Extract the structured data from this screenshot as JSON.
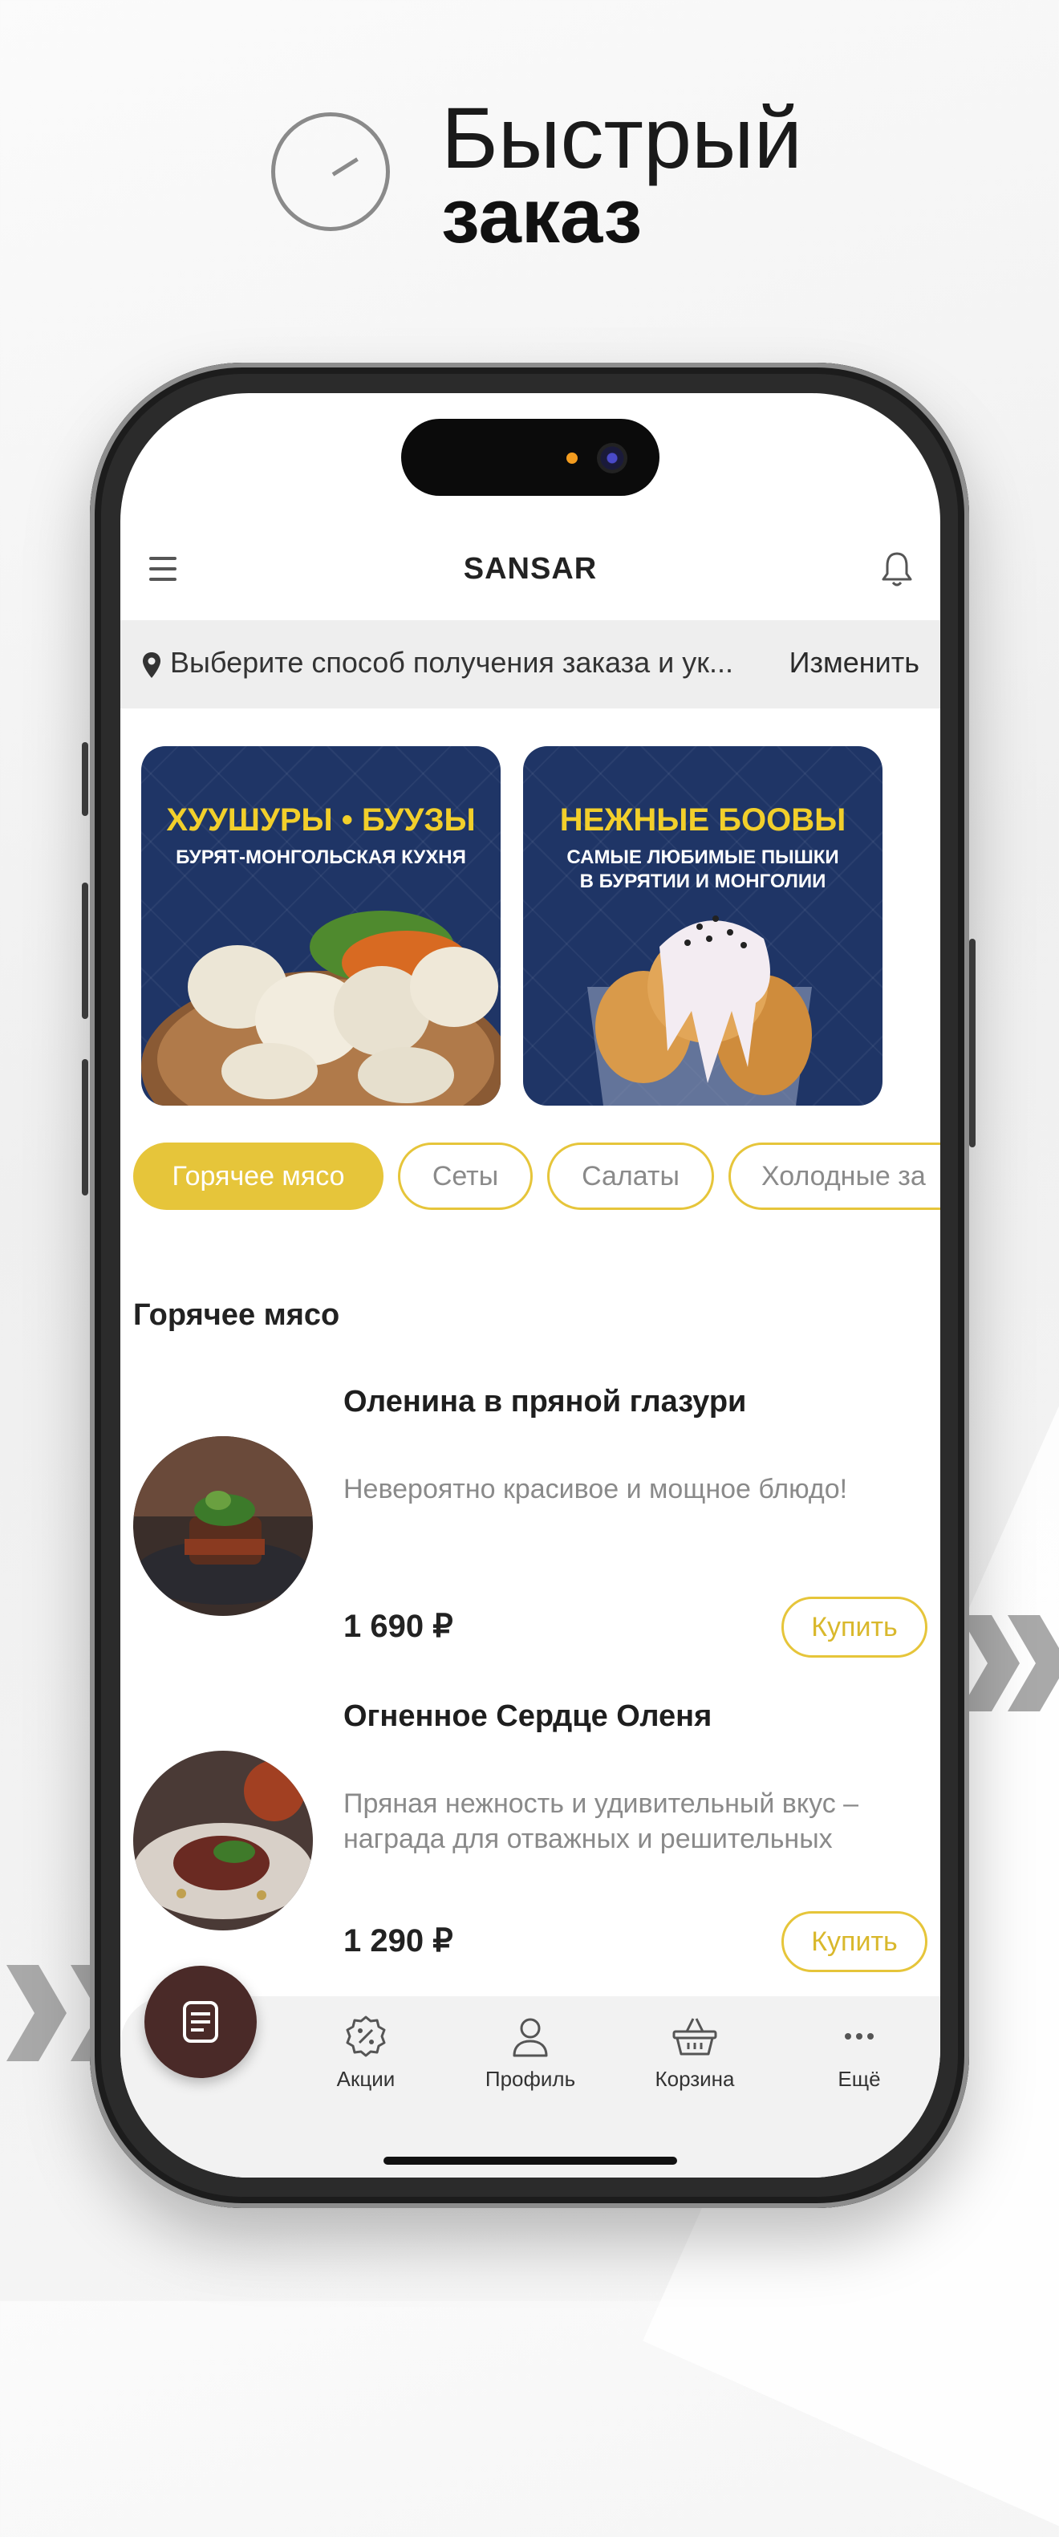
{
  "headline": {
    "line1": "Быстрый",
    "line2": "заказ"
  },
  "app": {
    "title": "SANSAR"
  },
  "address_bar": {
    "text": "Выберите способ получения заказа и ук...",
    "change_label": "Изменить"
  },
  "banners": [
    {
      "title": "ХУУШУРЫ • БУУЗЫ",
      "subtitle": "БУРЯТ-МОНГОЛЬСКАЯ КУХНЯ"
    },
    {
      "title": "НЕЖНЫЕ БООВЫ",
      "subtitle": "САМЫЕ ЛЮБИМЫЕ ПЫШКИ\nВ БУРЯТИИ И МОНГОЛИИ"
    }
  ],
  "categories": [
    "Горячее мясо",
    "Сеты",
    "Салаты",
    "Холодные за"
  ],
  "section": {
    "title": "Горячее мясо"
  },
  "items": [
    {
      "name": "Оленина в пряной глазури",
      "description": "Невероятно красивое и мощное блюдо!",
      "price": "1 690 ₽",
      "buy_label": "Купить"
    },
    {
      "name": "Огненное Сердце Оленя",
      "description": "Пряная нежность и удивительный вкус – награда для отважных и решительных",
      "price": "1 290 ₽",
      "buy_label": "Купить"
    }
  ],
  "bottom_nav": [
    {
      "label": "Акции",
      "icon": "discount-badge-icon"
    },
    {
      "label": "Профиль",
      "icon": "user-icon"
    },
    {
      "label": "Корзина",
      "icon": "basket-icon"
    },
    {
      "label": "Ещё",
      "icon": "more-dots-icon"
    }
  ],
  "colors": {
    "accent": "#e6c53a",
    "banner_bg": "#1f3566",
    "banner_title": "#f2cf2b",
    "fab": "#4a2a28",
    "address_bg": "#eeeeee"
  }
}
